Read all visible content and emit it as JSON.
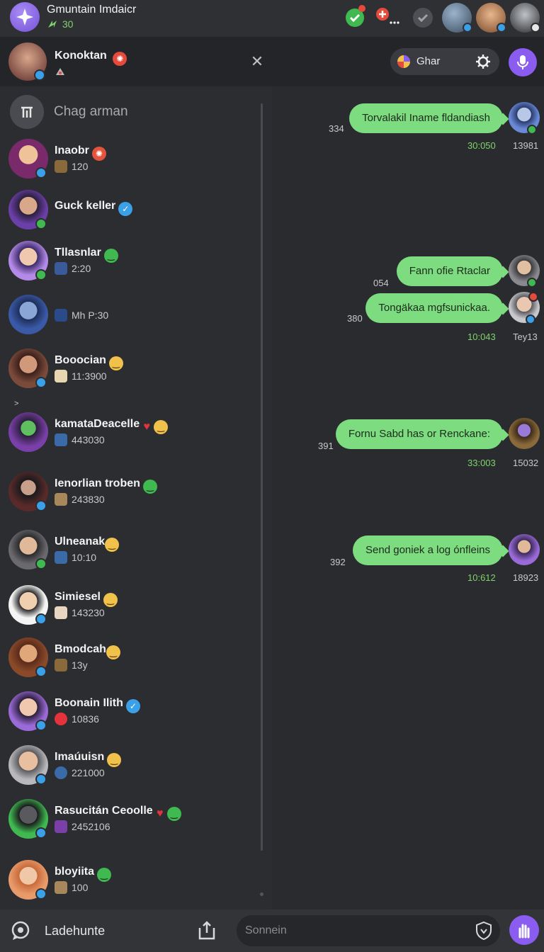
{
  "app": {
    "title": "Gmuntain Imdaicr",
    "sub_value": "30"
  },
  "header": {
    "name": "Konoktan",
    "chat_pill_label": "Ghar"
  },
  "sidebar": {
    "search_placeholder": "Chag arman",
    "collapse_mark": ">",
    "contacts": [
      {
        "name": "Inaobr",
        "sub": "120",
        "emoji": "red"
      },
      {
        "name": "Guck keller",
        "sub": "",
        "emoji": "blue-check"
      },
      {
        "name": "Tllasnlar",
        "sub": "2:20",
        "emoji": "green"
      },
      {
        "name": "",
        "sub": "Mh P:30",
        "emoji": ""
      },
      {
        "name": "Booocian",
        "sub": "11:3900",
        "emoji": "yellow"
      },
      {
        "name": "kamataDeacelle",
        "sub": "443030",
        "emoji": "heart-yellow"
      },
      {
        "name": "Ienorlian troben",
        "sub": "243830",
        "emoji": "green"
      },
      {
        "name": "Ulneanak",
        "sub": "10:10",
        "emoji": "yellow"
      },
      {
        "name": "Simiesel",
        "sub": "143230",
        "emoji": "yellow"
      },
      {
        "name": "Bmodcah",
        "sub": "13y",
        "emoji": "yellow"
      },
      {
        "name": "Boonain Ilith",
        "sub": "10836",
        "emoji": "blue-check"
      },
      {
        "name": "Imaúuisn",
        "sub": "221000",
        "emoji": "yellow"
      },
      {
        "name": "Rasucitán Ceoolle",
        "sub": "2452106",
        "emoji": "heart-green"
      },
      {
        "name": "bloyiita",
        "sub": "100",
        "emoji": "green"
      }
    ]
  },
  "messages": [
    {
      "text": "Torvalakil Iname fldandiash",
      "num": "334",
      "time": "30:050",
      "stamp": "13981"
    },
    {
      "text": "Fann ofie Rtaclar",
      "num": "054",
      "time": "",
      "stamp": ""
    },
    {
      "text": "Tongäkaa mgfsunickaa.",
      "num": "380",
      "time": "10:043",
      "stamp": "Tey13"
    },
    {
      "text": "Fornu Sabd has or Renckane:",
      "num": "391",
      "time": "33:003",
      "stamp": "15032"
    },
    {
      "text": "Send goniek a log ónfleins",
      "num": "392",
      "time": "10:612",
      "stamp": "18923"
    }
  ],
  "bottom": {
    "label": "Ladehunte",
    "composer_placeholder": "Sonnein"
  },
  "colors": {
    "accent": "#8b5cf0",
    "bubble": "#7ddc7f",
    "online": "#3fb950",
    "verified": "#3aa0e8"
  }
}
